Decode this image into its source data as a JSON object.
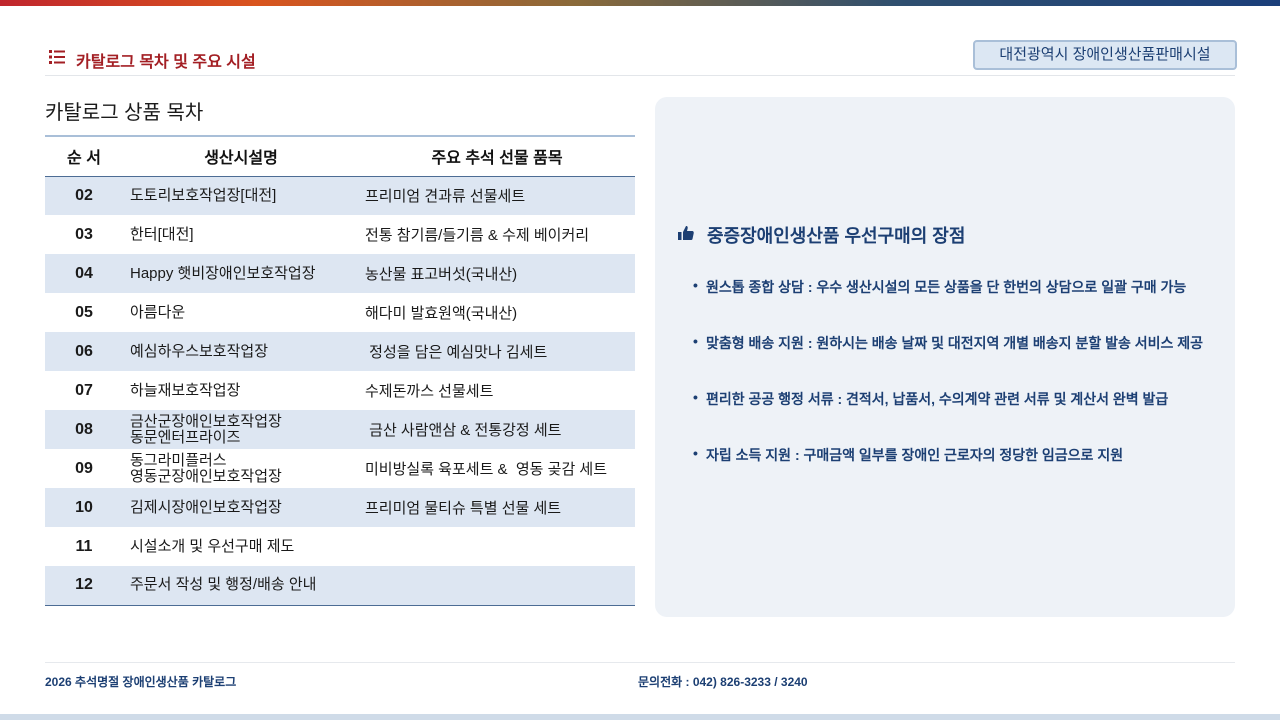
{
  "header": {
    "section_title": "카탈로그 목차 및 주요 시설",
    "badge": "대전광역시 장애인생산품판매시설",
    "icon": "list-icon"
  },
  "toc": {
    "title": "카탈로그 상품 목차",
    "columns": [
      "순 서",
      "생산시설명",
      "주요 추석 선물 품목"
    ],
    "rows": [
      {
        "num": "02",
        "facility": "도토리보호작업장[대전]",
        "facility2": "",
        "item": "프리미엄 견과류 선물세트"
      },
      {
        "num": "03",
        "facility": "한터[대전]",
        "facility2": "",
        "item": "전통 참기름/들기름 & 수제 베이커리"
      },
      {
        "num": "04",
        "facility": "Happy 햇비장애인보호작업장",
        "facility2": "",
        "item": "농산물 표고버섯(국내산)"
      },
      {
        "num": "05",
        "facility": "아름다운",
        "facility2": "",
        "item": "해다미 발효원액(국내산)"
      },
      {
        "num": "06",
        "facility": "예심하우스보호작업장",
        "facility2": "",
        "item": " 정성을 담은 예심맛나 김세트"
      },
      {
        "num": "07",
        "facility": "하늘재보호작업장",
        "facility2": "",
        "item": "수제돈까스 선물세트"
      },
      {
        "num": "08",
        "facility": "금산군장애인보호작업장",
        "facility2": "동문엔터프라이즈",
        "item": " 금산 사람앤삼 & 전통강정 세트"
      },
      {
        "num": "09",
        "facility": "동그라미플러스",
        "facility2": "영동군장애인보호작업장",
        "item": "미비방실록 육포세트 &  영동 곶감 세트"
      },
      {
        "num": "10",
        "facility": "김제시장애인보호작업장",
        "facility2": "",
        "item": "프리미엄 물티슈 특별 선물 세트"
      },
      {
        "num": "11",
        "facility": "시설소개 및 우선구매 제도",
        "facility2": "",
        "item": ""
      },
      {
        "num": "12",
        "facility": "주문서 작성 및 행정/배송 안내",
        "facility2": "",
        "item": ""
      }
    ]
  },
  "advantages": {
    "title": "중증장애인생산품 우선구매의 장점",
    "icon": "thumbs-up-icon",
    "items": [
      "원스톱 종합 상담 : 우수 생산시설의 모든 상품을 단 한번의 상담으로 일괄 구매 가능",
      "맞춤형 배송 지원 : 원하시는 배송 날짜 및 대전지역 개별 배송지 분할 발송 서비스 제공",
      "편리한 공공 행정 서류 : 견적서, 납품서, 수의계약 관련 서류 및 계산서 완벽 발급",
      "자립 소득 지원 : 구매금액 일부를 장애인 근로자의 정당한 임금으로 지원"
    ]
  },
  "footer": {
    "left": "2026 추석명절 장애인생산품 카탈로그",
    "right": "문의전화 : 042) 826-3233 / 3240"
  },
  "colors": {
    "accent_red": "#a31f24",
    "navy": "#1c3f73",
    "row_shade": "#dde6f2",
    "panel": "#eef2f7"
  }
}
